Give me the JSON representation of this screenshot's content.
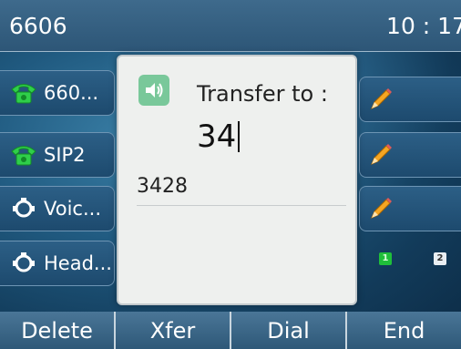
{
  "status_bar": {
    "account": "6606",
    "time": "10 : 17"
  },
  "left_keys": [
    {
      "label": "660...",
      "icon": "phone-icon"
    },
    {
      "label": "SIP2",
      "icon": "phone-icon"
    },
    {
      "label": "Voic...",
      "icon": "voicemail-icon"
    },
    {
      "label": "Head...",
      "icon": "headset-icon"
    }
  ],
  "right_keys": [
    {
      "icon": "pencil-icon"
    },
    {
      "icon": "pencil-icon"
    },
    {
      "icon": "pencil-icon"
    }
  ],
  "pages": [
    "1",
    "2"
  ],
  "dialog": {
    "title": "Transfer to :",
    "entry": "34",
    "suggestion": "3428"
  },
  "softkeys": [
    "Delete",
    "Xfer",
    "Dial",
    "End"
  ],
  "colors": {
    "accent_green": "#1fbf3a",
    "bar": "#2d5677"
  }
}
